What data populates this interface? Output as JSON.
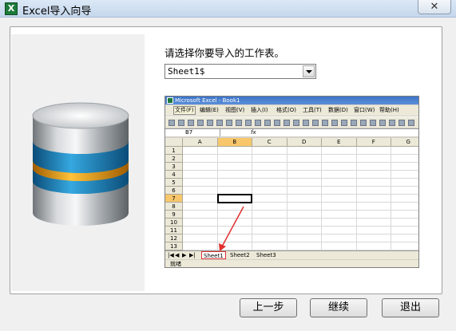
{
  "window": {
    "title": "Excel导入向导",
    "close_label": "✕",
    "app_icon_letter": "X"
  },
  "wizard": {
    "prompt": "请选择你要导入的工作表。",
    "sheet_select_value": "Sheet1$"
  },
  "excel_preview": {
    "title": "Microsoft Excel - Book1",
    "menu": [
      "文件(F)",
      "编辑(E)",
      "视图(V)",
      "插入(I)",
      "格式(O)",
      "工具(T)",
      "数据(D)",
      "窗口(W)",
      "帮助(H)"
    ],
    "name_box": "B7",
    "fx_label": "fx",
    "columns": [
      "A",
      "B",
      "C",
      "D",
      "E",
      "F",
      "G"
    ],
    "rows": [
      "1",
      "2",
      "3",
      "4",
      "5",
      "6",
      "7",
      "8",
      "9",
      "10",
      "11",
      "12",
      "13"
    ],
    "selected_column": "B",
    "selected_row": "7",
    "sheet_tabs": [
      "Sheet1",
      "Sheet2",
      "Sheet3"
    ],
    "status": "就绪",
    "highlight_color": "#e03030"
  },
  "buttons": {
    "prev": "上一步",
    "next": "继续",
    "exit": "退出"
  },
  "icons": {
    "database": "database-icon",
    "app": "excel-icon"
  }
}
